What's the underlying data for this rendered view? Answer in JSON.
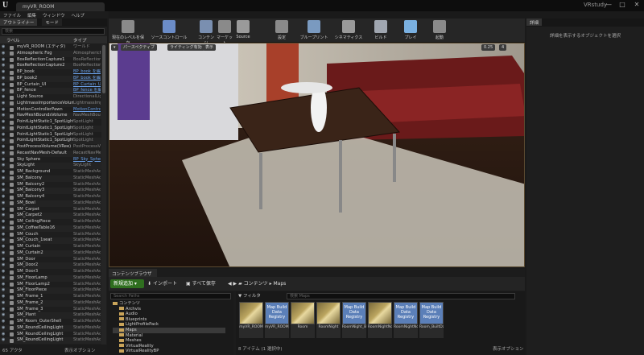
{
  "window": {
    "doc_tab": "myVR_ROOM",
    "project": "VRstudy",
    "min": "—",
    "max": "□",
    "close": "✕"
  },
  "menu": [
    "ファイル",
    "編集",
    "ウィンドウ",
    "ヘルプ"
  ],
  "outliner": {
    "tab_label": "アウトライナー",
    "modes_tab": "モード",
    "search_placeholder": "検索",
    "col_label": "ラベル",
    "col_type": "タイプ",
    "rows": [
      {
        "name": "myVR_ROOM (エディタ)",
        "type": "ワールド",
        "link": false
      },
      {
        "name": "Atmospheric Fog",
        "type": "AtmosphericFog",
        "link": false
      },
      {
        "name": "BoxReflectionCapture1",
        "type": "BoxReflectionCapture",
        "link": false
      },
      {
        "name": "BoxReflectionCapture2",
        "type": "BoxReflectionCapture",
        "link": false
      },
      {
        "name": "BP_book",
        "type": "BP_book を編集",
        "link": true
      },
      {
        "name": "BP_book2",
        "type": "BP_book を編集",
        "link": true
      },
      {
        "name": "BP_Curtain_UI",
        "type": "BP_Curtain_UI を編集",
        "link": true
      },
      {
        "name": "BP_fence",
        "type": "BP_fence を編集",
        "link": true
      },
      {
        "name": "Light Source",
        "type": "DirectionalLight",
        "link": false
      },
      {
        "name": "LightmassImportanceVolume",
        "type": "LightmassImportanceVolume",
        "link": false
      },
      {
        "name": "MotionControllerPawn",
        "type": "MotionControllerPawn",
        "link": true
      },
      {
        "name": "NavMeshBoundsVolume",
        "type": "NavMeshBoundsVolume",
        "link": false
      },
      {
        "name": "PointLightStatic1_SpotLight",
        "type": "SpotLight",
        "link": false
      },
      {
        "name": "PointLightStatic1_SpotLight",
        "type": "SpotLight",
        "link": false
      },
      {
        "name": "PointLightStatic1_SpotLight",
        "type": "SpotLight",
        "link": false
      },
      {
        "name": "PointLightStatic1_SpotLight",
        "type": "SpotLight",
        "link": false
      },
      {
        "name": "PostProcessVolume(VRee)",
        "type": "PostProcessVolume",
        "link": false
      },
      {
        "name": "RecastNavMesh-Default",
        "type": "RecastNavMesh",
        "link": false
      },
      {
        "name": "Sky Sphere",
        "type": "BP_Sky_Sphere",
        "link": true
      },
      {
        "name": "SkyLight",
        "type": "SkyLight",
        "link": false
      },
      {
        "name": "SM_Background",
        "type": "StaticMeshActor",
        "link": false
      },
      {
        "name": "SM_Balcony",
        "type": "StaticMeshActor",
        "link": false
      },
      {
        "name": "SM_Balcony2",
        "type": "StaticMeshActor",
        "link": false
      },
      {
        "name": "SM_Balcony3",
        "type": "StaticMeshActor",
        "link": false
      },
      {
        "name": "SM_Balcony4",
        "type": "StaticMeshActor",
        "link": false
      },
      {
        "name": "SM_Bowl",
        "type": "StaticMeshActor",
        "link": false
      },
      {
        "name": "SM_Carpet",
        "type": "StaticMeshActor",
        "link": false
      },
      {
        "name": "SM_Carpet2",
        "type": "StaticMeshActor",
        "link": false
      },
      {
        "name": "SM_CeilingPiece",
        "type": "StaticMeshActor",
        "link": false
      },
      {
        "name": "SM_CoffeeTable16",
        "type": "StaticMeshActor",
        "link": false
      },
      {
        "name": "SM_Couch",
        "type": "StaticMeshActor",
        "link": false
      },
      {
        "name": "SM_Couch_1seat",
        "type": "StaticMeshActor",
        "link": false
      },
      {
        "name": "SM_Curtain",
        "type": "StaticMeshActor",
        "link": false
      },
      {
        "name": "SM_Curtain2",
        "type": "StaticMeshActor",
        "link": false
      },
      {
        "name": "SM_Door",
        "type": "StaticMeshActor",
        "link": false
      },
      {
        "name": "SM_Door2",
        "type": "StaticMeshActor",
        "link": false
      },
      {
        "name": "SM_Door3",
        "type": "StaticMeshActor",
        "link": false
      },
      {
        "name": "SM_FloorLamp",
        "type": "StaticMeshActor",
        "link": false
      },
      {
        "name": "SM_FloorLamp2",
        "type": "StaticMeshActor",
        "link": false
      },
      {
        "name": "SM_FloorPiece",
        "type": "StaticMeshActor",
        "link": false
      },
      {
        "name": "SM_Frame_1",
        "type": "StaticMeshActor",
        "link": false
      },
      {
        "name": "SM_Frame_2",
        "type": "StaticMeshActor",
        "link": false
      },
      {
        "name": "SM_Frame_3",
        "type": "StaticMeshActor",
        "link": false
      },
      {
        "name": "SM_Plant",
        "type": "StaticMeshActor",
        "link": false
      },
      {
        "name": "SM_Room_OuterShell",
        "type": "StaticMeshActor",
        "link": false
      },
      {
        "name": "SM_RoundCeilingLight",
        "type": "StaticMeshActor",
        "link": false
      },
      {
        "name": "SM_RoundCeilingLight",
        "type": "StaticMeshActor",
        "link": false
      },
      {
        "name": "SM_RoundCeilingLight",
        "type": "StaticMeshActor",
        "link": false
      }
    ],
    "status": "65 アクタ",
    "view_options": "表示オプション"
  },
  "toolbar": [
    {
      "label": "現在のレベルを保存",
      "icon": "save-icon",
      "color": "#8a8a8a"
    },
    {
      "label": "ソースコントロール",
      "icon": "source-control-icon",
      "color": "#6b8cc7"
    },
    {
      "label": "コンテンツ",
      "icon": "content-icon",
      "color": "#7a8fb0"
    },
    {
      "label": "マーケット",
      "icon": "market-icon",
      "color": "#8a8a8a"
    },
    {
      "label": "Source",
      "icon": "source-icon",
      "color": "#9a9a9a"
    },
    {
      "label": "設定",
      "icon": "settings-icon",
      "color": "#8a8a8a"
    },
    {
      "label": "ブループリント",
      "icon": "blueprint-icon",
      "color": "#7a9ac0"
    },
    {
      "label": "シネマティクス",
      "icon": "cinematics-icon",
      "color": "#9a9a9a"
    },
    {
      "label": "ビルド",
      "icon": "build-icon",
      "color": "#a0a6b0"
    },
    {
      "label": "プレイ",
      "icon": "play-icon",
      "color": "#7ab0e0"
    },
    {
      "label": "起動",
      "icon": "launch-icon",
      "color": "#8a8a8a"
    }
  ],
  "viewport": {
    "perspective": "パースペクティブ",
    "lit": "ライティング有効",
    "show": "表示",
    "snap_value": "0.25",
    "speed": "4"
  },
  "content_browser": {
    "tab": "コンテンツブラウザ",
    "add_new": "新規追加",
    "import": "インポート",
    "save_all": "すべて保存",
    "path_root": "コンテンツ",
    "path_leaf": "Maps",
    "folder_search": "Search Paths",
    "folders": [
      "コンテンツ",
      "Archvis",
      "Audio",
      "Blueprints",
      "LightProfilePack",
      "Maps",
      "Material",
      "Meshes",
      "VirtualReality",
      "VirtualRealityBP"
    ],
    "filter": "フィルタ",
    "asset_search": "検索 Maps",
    "assets": [
      {
        "kind": "map",
        "label": "myVR_ROOM",
        "thumb": ""
      },
      {
        "kind": "reg",
        "label": "myVR_ROOM_BuiltData",
        "thumb": "Map Build Data Registry"
      },
      {
        "kind": "map",
        "label": "Room",
        "thumb": ""
      },
      {
        "kind": "map",
        "label": "RoomNight",
        "thumb": ""
      },
      {
        "kind": "reg",
        "label": "RoomNight_BuiltData",
        "thumb": "Map Build Data Registry"
      },
      {
        "kind": "map",
        "label": "RoomNightNoLights",
        "thumb": ""
      },
      {
        "kind": "reg",
        "label": "RoomNightNoLights_BuiltData",
        "thumb": "Map Build Data Registry"
      },
      {
        "kind": "reg",
        "label": "Room_BuiltData",
        "thumb": "Map Build Data Registry"
      }
    ],
    "status": "8 アイテム (1 選択中)",
    "view_options": "表示オプション"
  },
  "details": {
    "tab": "詳細",
    "message": "詳細を表示するオブジェクトを選択"
  }
}
